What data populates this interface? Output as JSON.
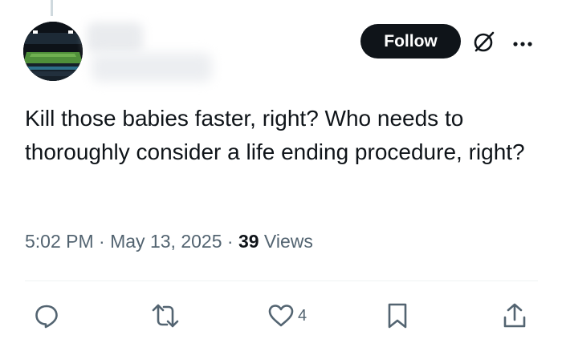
{
  "author": {
    "avatar_icon": "stadium-avatar-icon",
    "name_blurred": true
  },
  "header": {
    "follow_label": "Follow",
    "grok_icon": "grok-icon",
    "more_icon": "more-options-icon"
  },
  "tweet": {
    "text": "Kill those babies faster, right? Who needs to thoroughly consider a life ending procedure, right?",
    "time": "5:02 PM",
    "separator": "·",
    "date": "May 13, 2025",
    "views_count": "39",
    "views_label": "Views"
  },
  "actions": {
    "reply_icon": "reply-icon",
    "retweet_icon": "retweet-icon",
    "like_icon": "like-icon",
    "like_count": "4",
    "bookmark_icon": "bookmark-icon",
    "share_icon": "share-icon"
  },
  "colors": {
    "text_primary": "#0f1419",
    "text_secondary": "#536471",
    "button_bg": "#0f1419",
    "divider": "#eff3f4"
  }
}
